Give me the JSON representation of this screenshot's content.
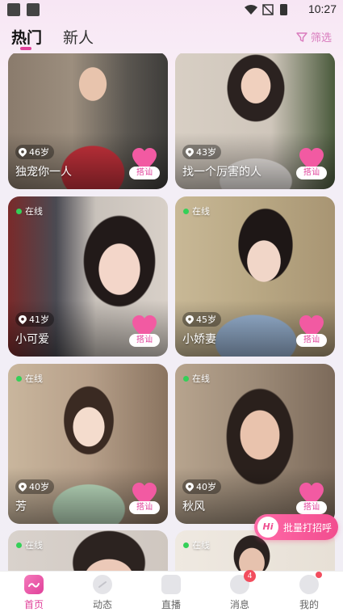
{
  "status_bar": {
    "time": "10:27"
  },
  "tabs": {
    "hot": "热门",
    "new": "新人",
    "filter": "筛选"
  },
  "cards": [
    {
      "age": "46岁",
      "name": "独宠你一人",
      "online": "",
      "chat": "搭讪"
    },
    {
      "age": "43岁",
      "name": "找一个厉害的人",
      "online": "",
      "chat": "搭讪"
    },
    {
      "age": "41岁",
      "name": "小可爱",
      "online": "在线",
      "chat": "搭讪"
    },
    {
      "age": "45岁",
      "name": "小娇妻",
      "online": "在线",
      "chat": "搭讪"
    },
    {
      "age": "40岁",
      "name": "芳",
      "online": "在线",
      "chat": "搭讪"
    },
    {
      "age": "40岁",
      "name": "秋风",
      "online": "在线",
      "chat": "搭讪"
    },
    {
      "age": "",
      "name": "",
      "online": "在线",
      "chat": ""
    },
    {
      "age": "",
      "name": "",
      "online": "在线",
      "chat": ""
    }
  ],
  "batch_greet": {
    "hi": "Hi",
    "label": "批量打招呼"
  },
  "bottom_nav": [
    {
      "label": "首页",
      "icon": "home-icon"
    },
    {
      "label": "动态",
      "icon": "moments-icon"
    },
    {
      "label": "直播",
      "icon": "live-icon"
    },
    {
      "label": "消息",
      "icon": "message-icon",
      "badge": "4"
    },
    {
      "label": "我的",
      "icon": "profile-icon"
    }
  ],
  "colors": {
    "accent": "#e0409a",
    "online": "#34d058",
    "badge": "#f24d5e"
  }
}
